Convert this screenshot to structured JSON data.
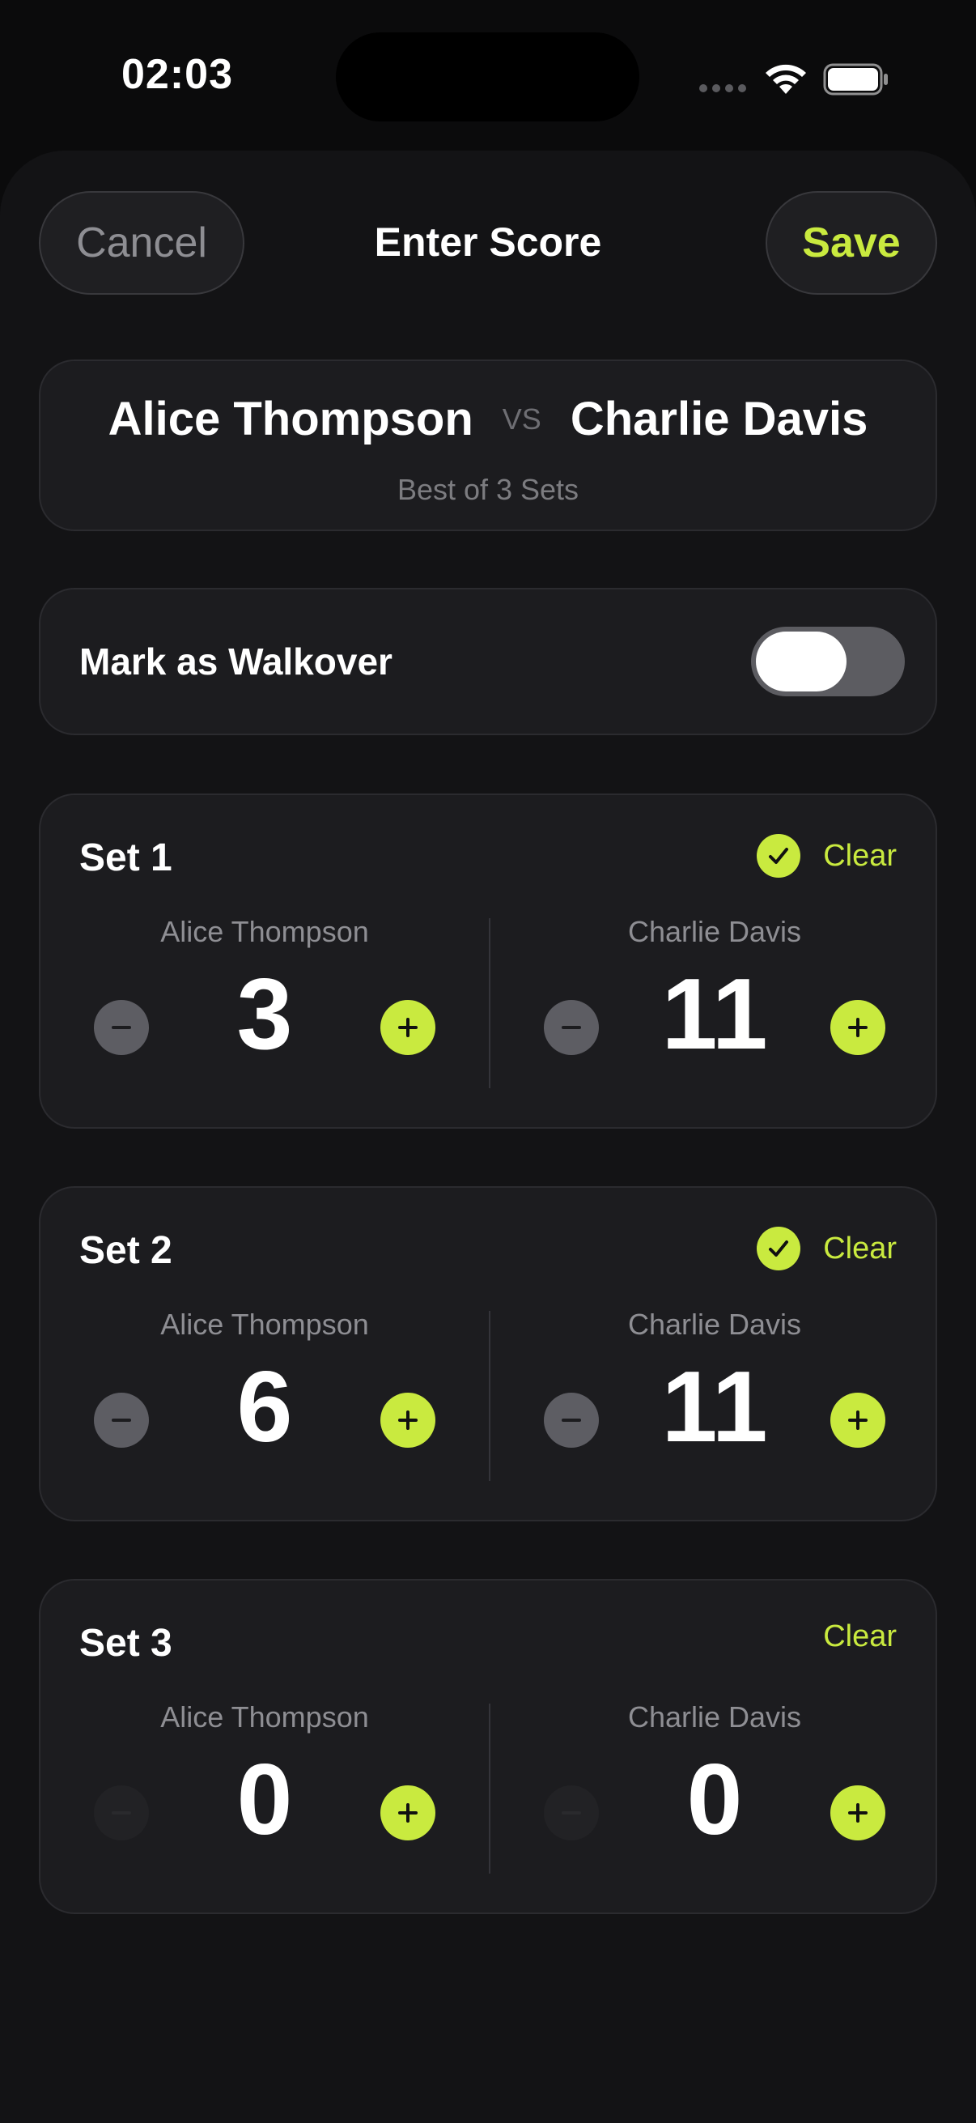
{
  "status_bar": {
    "time": "02:03"
  },
  "header": {
    "cancel_label": "Cancel",
    "title": "Enter Score",
    "save_label": "Save"
  },
  "match": {
    "player1": "Alice Thompson",
    "vs": "VS",
    "player2": "Charlie Davis",
    "format": "Best of 3 Sets"
  },
  "walkover": {
    "label": "Mark as Walkover",
    "enabled": false
  },
  "sets": [
    {
      "title": "Set 1",
      "clear_label": "Clear",
      "complete": true,
      "p1_name": "Alice Thompson",
      "p1_score": "3",
      "p2_name": "Charlie Davis",
      "p2_score": "11"
    },
    {
      "title": "Set 2",
      "clear_label": "Clear",
      "complete": true,
      "p1_name": "Alice Thompson",
      "p1_score": "6",
      "p2_name": "Charlie Davis",
      "p2_score": "11"
    },
    {
      "title": "Set 3",
      "clear_label": "Clear",
      "complete": false,
      "p1_name": "Alice Thompson",
      "p1_score": "0",
      "p2_name": "Charlie Davis",
      "p2_score": "0"
    }
  ],
  "colors": {
    "accent": "#c9ea3f",
    "background": "#0b0b0c",
    "card": "#1c1c1f"
  },
  "icons": [
    "wifi-icon",
    "battery-icon",
    "check-icon",
    "minus-icon",
    "plus-icon"
  ]
}
